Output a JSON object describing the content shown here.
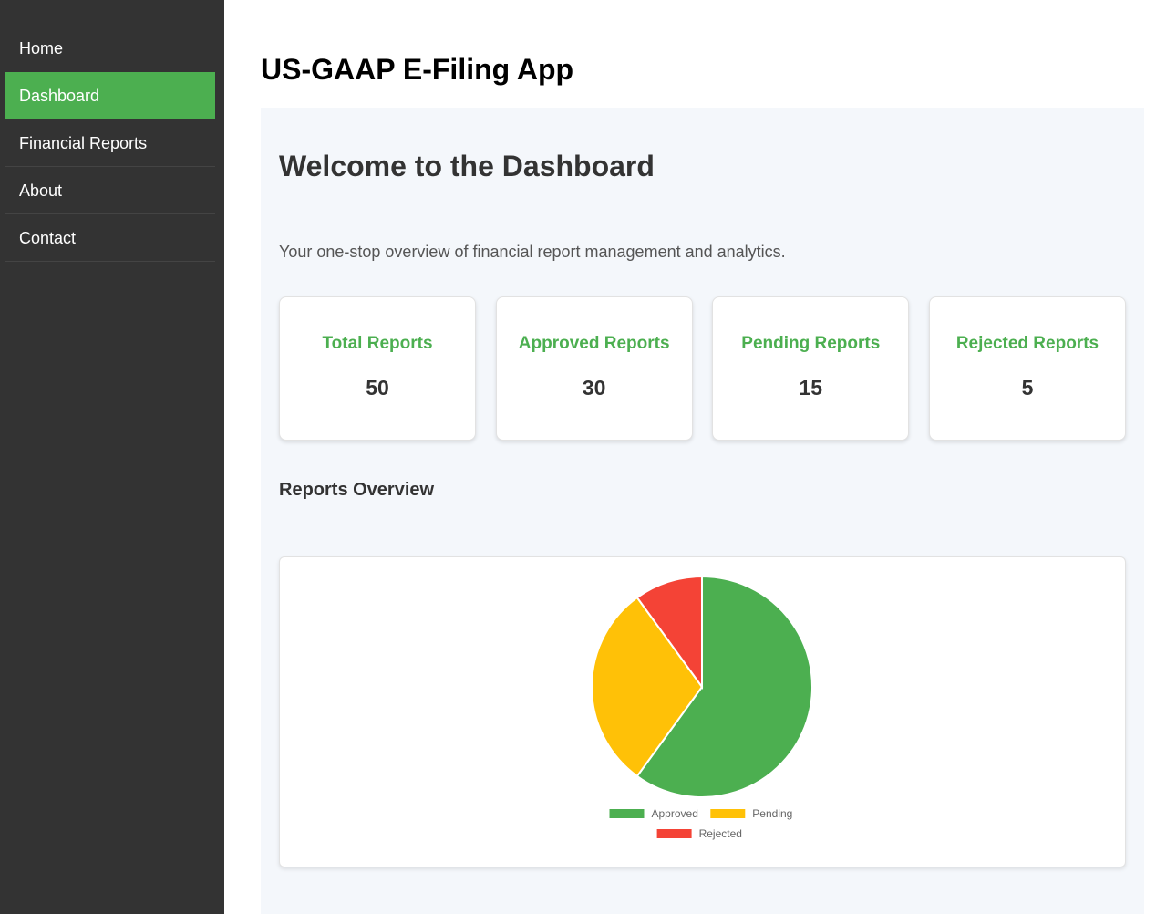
{
  "sidebar": {
    "items": [
      {
        "label": "Home",
        "active": false
      },
      {
        "label": "Dashboard",
        "active": true
      },
      {
        "label": "Financial Reports",
        "active": false
      },
      {
        "label": "About",
        "active": false
      },
      {
        "label": "Contact",
        "active": false
      }
    ]
  },
  "header": {
    "title": "US-GAAP E-Filing App"
  },
  "main": {
    "welcome": "Welcome to the Dashboard",
    "intro": "Your one-stop overview of financial report management and analytics.",
    "cards": [
      {
        "title": "Total Reports",
        "value": "50"
      },
      {
        "title": "Approved Reports",
        "value": "30"
      },
      {
        "title": "Pending Reports",
        "value": "15"
      },
      {
        "title": "Rejected Reports",
        "value": "5"
      }
    ],
    "section_title": "Reports Overview"
  },
  "colors": {
    "accent": "#4caf50",
    "sidebar": "#333333",
    "approved": "#4caf50",
    "pending": "#ffc107",
    "rejected": "#f44336"
  },
  "chart_data": {
    "type": "pie",
    "categories": [
      "Approved",
      "Pending",
      "Rejected"
    ],
    "values": [
      30,
      15,
      5
    ],
    "colors": [
      "#4caf50",
      "#ffc107",
      "#f44336"
    ],
    "legend": "bottom"
  }
}
